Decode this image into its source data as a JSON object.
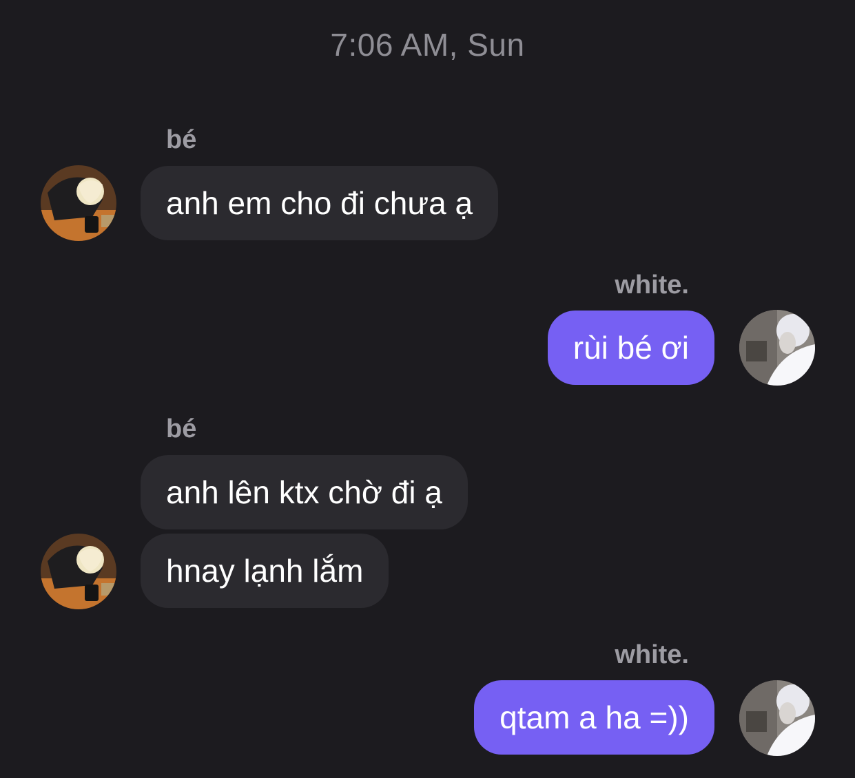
{
  "timestamp": "7:06 AM, Sun",
  "messages": [
    {
      "sender": "bé",
      "text": "anh em cho đi chưa ạ"
    },
    {
      "sender": "white.",
      "text": "rùi bé ơi"
    },
    {
      "sender": "bé",
      "text": "anh lên ktx chờ đi ạ"
    },
    {
      "text": "hnay lạnh lắm"
    },
    {
      "sender": "white.",
      "text": "qtam a ha =))"
    }
  ],
  "colors": {
    "background": "#1c1b1f",
    "incoming_bubble": "#2b2a2f",
    "outgoing_bubble": "#7660f3",
    "meta_text": "#8f8e95"
  },
  "icons": {
    "be_avatar": "avatar-be-photo",
    "white_avatar": "avatar-white-photo"
  }
}
